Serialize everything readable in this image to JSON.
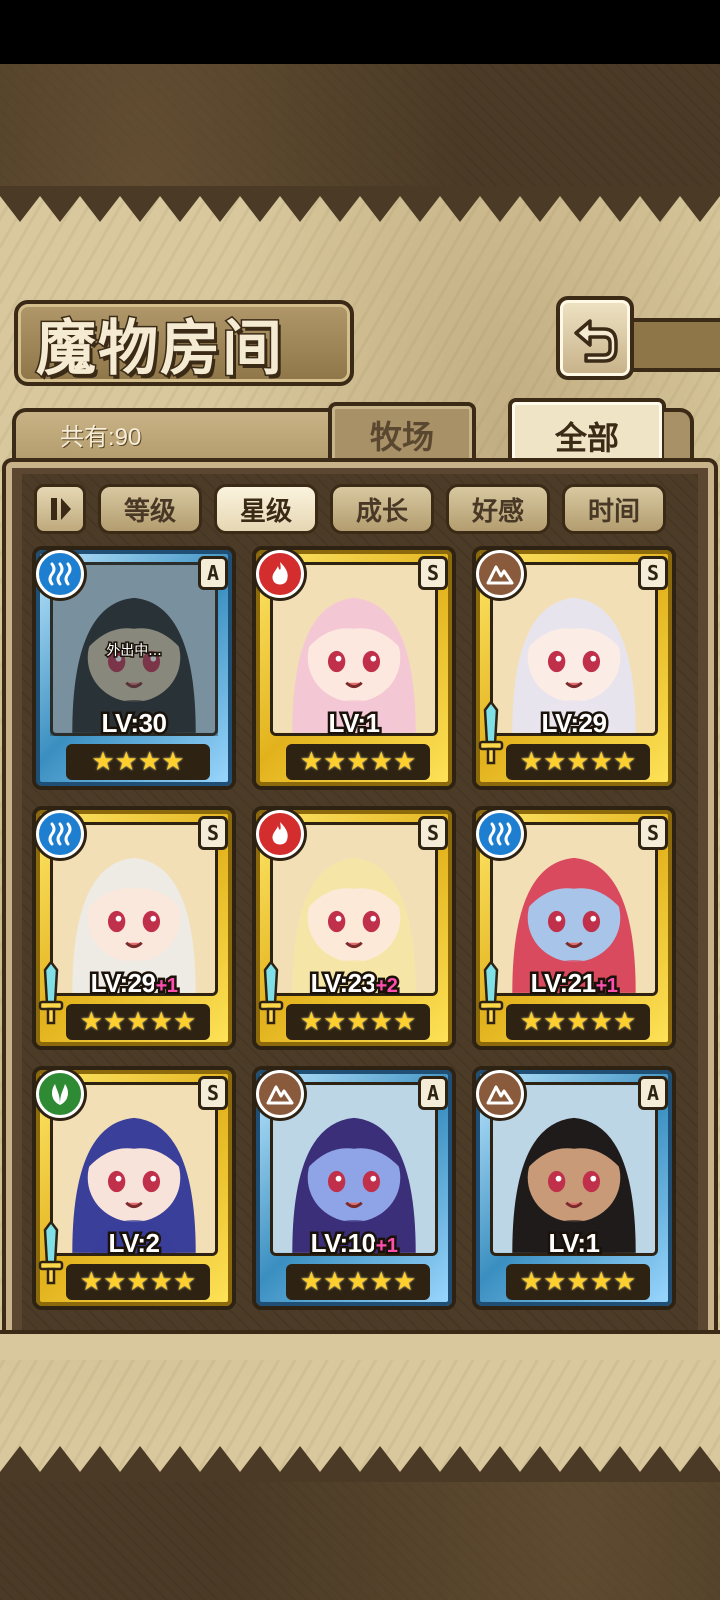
{
  "header": {
    "title": "魔物房间",
    "back_icon": "return-arrow-icon"
  },
  "tabs": {
    "count_label": "共有:90",
    "farm": "牧场",
    "all": "全部",
    "active": "全部"
  },
  "sort": {
    "toggle_icon": "pause-sort-icon",
    "buttons": [
      "等级",
      "星级",
      "成长",
      "好感",
      "时间"
    ],
    "active": "星级"
  },
  "monsters": [
    {
      "element": "water",
      "rank": "A",
      "frame": "blue",
      "level": "LV:30",
      "bonus": "",
      "stars": 4,
      "status": "外出中...",
      "weapon": false,
      "hair": "#2a2a2a",
      "skin": "#d8c6a8"
    },
    {
      "element": "fire",
      "rank": "S",
      "frame": "gold",
      "level": "LV:1",
      "bonus": "",
      "stars": 5,
      "status": "",
      "weapon": false,
      "hair": "#f3c7d4",
      "skin": "#fde8df"
    },
    {
      "element": "earth",
      "rank": "S",
      "frame": "gold",
      "level": "LV:29",
      "bonus": "",
      "stars": 5,
      "status": "",
      "weapon": true,
      "hair": "#e8e4ee",
      "skin": "#fbece6"
    },
    {
      "element": "water",
      "rank": "S",
      "frame": "gold",
      "level": "LV:29",
      "bonus": "+1",
      "stars": 5,
      "status": "",
      "weapon": true,
      "hair": "#eeeae4",
      "skin": "#fbe8dc"
    },
    {
      "element": "fire",
      "rank": "S",
      "frame": "gold",
      "level": "LV:23",
      "bonus": "+2",
      "stars": 5,
      "status": "",
      "weapon": true,
      "hair": "#f5e6a8",
      "skin": "#fce9d8"
    },
    {
      "element": "water",
      "rank": "S",
      "frame": "gold",
      "level": "LV:21",
      "bonus": "+1",
      "stars": 5,
      "status": "",
      "weapon": true,
      "hair": "#d94a5e",
      "skin": "#a8c4e8"
    },
    {
      "element": "wind",
      "rank": "S",
      "frame": "gold",
      "level": "LV:2",
      "bonus": "",
      "stars": 5,
      "status": "",
      "weapon": true,
      "hair": "#3a3f9a",
      "skin": "#f8e3da"
    },
    {
      "element": "earth",
      "rank": "A",
      "frame": "blue",
      "level": "LV:10",
      "bonus": "+1",
      "stars": 5,
      "status": "",
      "weapon": false,
      "hair": "#3c2f7a",
      "skin": "#8fa4e6"
    },
    {
      "element": "earth",
      "rank": "A",
      "frame": "blue",
      "level": "LV:1",
      "bonus": "",
      "stars": 5,
      "status": "",
      "weapon": false,
      "hair": "#1f1b1b",
      "skin": "#c89a78"
    }
  ],
  "colors": {
    "water": "#1e7fd0",
    "fire": "#d42d2d",
    "earth": "#8a5a3c",
    "wind": "#2f8a34",
    "star": "#ffcf2e",
    "bonus": "#ff4fb0"
  }
}
